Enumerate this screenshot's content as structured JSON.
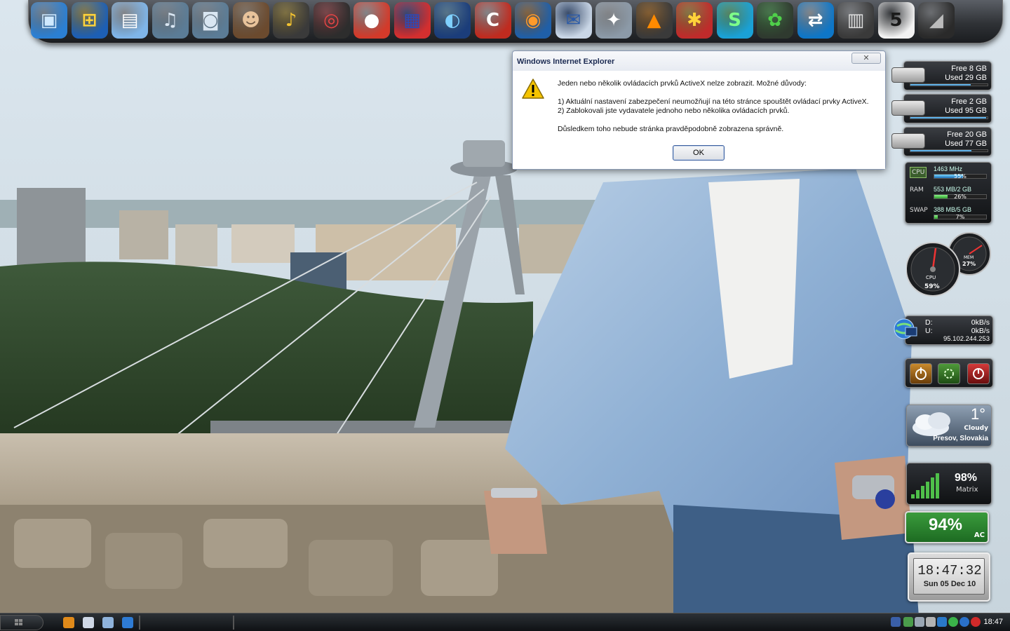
{
  "dock": {
    "items": [
      {
        "name": "display-monitor-icon",
        "glyph": "▣",
        "bg": "#2b7fd3",
        "fg": "#cfe9ff"
      },
      {
        "name": "windows-start-icon",
        "glyph": "⊞",
        "bg": "#1d5fb4",
        "fg": "#ffd23a"
      },
      {
        "name": "my-computer-icon",
        "glyph": "▤",
        "bg": "#7fb5e8",
        "fg": "#ffffff"
      },
      {
        "name": "audio-app-icon",
        "glyph": "♫",
        "bg": "#5b7c96",
        "fg": "#d9e6f2"
      },
      {
        "name": "camera-app-icon",
        "glyph": "◙",
        "bg": "#5b7c96",
        "fg": "#d9e6f2"
      },
      {
        "name": "tomb-raider-game-icon",
        "glyph": "☻",
        "bg": "#6b4a2e",
        "fg": "#e8c39b"
      },
      {
        "name": "trumpet-app-icon",
        "glyph": "♪",
        "bg": "#3a3a3a",
        "fg": "#f2c230"
      },
      {
        "name": "poker-chips-icon",
        "glyph": "◎",
        "bg": "#2d2d2d",
        "fg": "#e64545"
      },
      {
        "name": "burning-app-icon",
        "glyph": "●",
        "bg": "#d33a2a",
        "fg": "#ffffff"
      },
      {
        "name": "floppy-save-icon",
        "glyph": "▦",
        "bg": "#d32f2f",
        "fg": "#2b4ab8"
      },
      {
        "name": "google-earth-icon",
        "glyph": "◐",
        "bg": "#1b3d7a",
        "fg": "#7fd0ff"
      },
      {
        "name": "ccleaner-icon",
        "glyph": "C",
        "bg": "#c02b1f",
        "fg": "#ffffff"
      },
      {
        "name": "firefox-icon",
        "glyph": "◉",
        "bg": "#1f5fa8",
        "fg": "#ff9a2a"
      },
      {
        "name": "mail-sync-icon",
        "glyph": "✉",
        "bg": "#c9d6e6",
        "fg": "#2a5aa8"
      },
      {
        "name": "thunderbird-icon",
        "glyph": "✦",
        "bg": "#8c9aa8",
        "fg": "#ffffff"
      },
      {
        "name": "vlc-player-icon",
        "glyph": "▲",
        "bg": "#3a3a3a",
        "fg": "#ff8a00"
      },
      {
        "name": "spider-gift-icon",
        "glyph": "✱",
        "bg": "#c02b2b",
        "fg": "#ffd23a"
      },
      {
        "name": "skype-icon",
        "glyph": "S",
        "bg": "#1aa1d6",
        "fg": "#7dff8a"
      },
      {
        "name": "icq-icon",
        "glyph": "✿",
        "bg": "#2f3a2f",
        "fg": "#4fd04a"
      },
      {
        "name": "teamviewer-icon",
        "glyph": "⇄",
        "bg": "#0e76c7",
        "fg": "#ffffff"
      },
      {
        "name": "movie-clapper-icon",
        "glyph": "▥",
        "bg": "#3a3a3a",
        "fg": "#dddddd"
      },
      {
        "name": "calendar-icon",
        "glyph": "5",
        "bg": "#f2f2f2",
        "fg": "#1b1b1b"
      },
      {
        "name": "dock-end-icon",
        "glyph": "◢",
        "bg": "#2a2a2a",
        "fg": "#bbbbbb"
      }
    ]
  },
  "dialog": {
    "title": "Windows Internet Explorer",
    "close_label": "✕",
    "lines": [
      "Jeden nebo několik ovládacích prvků ActiveX nelze zobrazit. Možné důvody:",
      "",
      "1) Aktuální nastavení zabezpečení neumožňují na této stránce spouštět ovládací prvky ActiveX.",
      "2) Zablokovali jste vydavatele jednoho nebo několika ovládacích prvků.",
      "",
      "Důsledkem toho nebude stránka pravděpodobně zobrazena správně."
    ],
    "ok_label": "OK"
  },
  "disks": [
    {
      "free": "Free 8 GB",
      "used": "Used 29 GB",
      "fill": 0.78
    },
    {
      "free": "Free 2 GB",
      "used": "Used 95 GB",
      "fill": 0.98
    },
    {
      "free": "Free 20 GB",
      "used": "Used 77 GB",
      "fill": 0.79
    }
  ],
  "system_monitor": {
    "cpu": {
      "label": "CPU",
      "value": "1463 MHz",
      "pct": "55%",
      "fill": 0.55
    },
    "ram": {
      "label": "RAM",
      "value": "553 MB/2 GB",
      "pct": "26%",
      "fill": 0.26
    },
    "swap": {
      "label": "SWAP",
      "value": "388 MB/5 GB",
      "pct": "7%",
      "fill": 0.07
    }
  },
  "gauges": {
    "cpu_label": "CPU",
    "cpu_pct": "59%",
    "mem_label": "MEM",
    "mem_pct": "27%"
  },
  "network": {
    "down_label": "D:",
    "down_value": "0kB/s",
    "up_label": "U:",
    "up_value": "0kB/s",
    "ip": "95.102.244.253"
  },
  "weather": {
    "temp": "1°",
    "condition": "Cloudy",
    "location": "Presov, Slovakia"
  },
  "wifi": {
    "pct": "98%",
    "network": "Matrix"
  },
  "battery": {
    "pct": "94%",
    "source": "AC"
  },
  "clock": {
    "time": "18:47:32",
    "date": "Sun 05 Dec 10"
  },
  "taskbar": {
    "time": "18:47",
    "quick_launch": [
      "info-icon",
      "notepad-icon",
      "search-window-icon",
      "ie-icon"
    ],
    "tray": [
      "shield-tray-icon",
      "network-tray-icon",
      "wifi-tray-icon",
      "volume-tray-icon",
      "windows-tray-icon",
      "green-tray-icon",
      "update-tray-icon",
      "red-tray-icon"
    ]
  },
  "colors": {
    "dialog_accent": "#1b2a52",
    "dock_bg": "#2f3236",
    "taskbar_bg": "#1a1d21"
  }
}
